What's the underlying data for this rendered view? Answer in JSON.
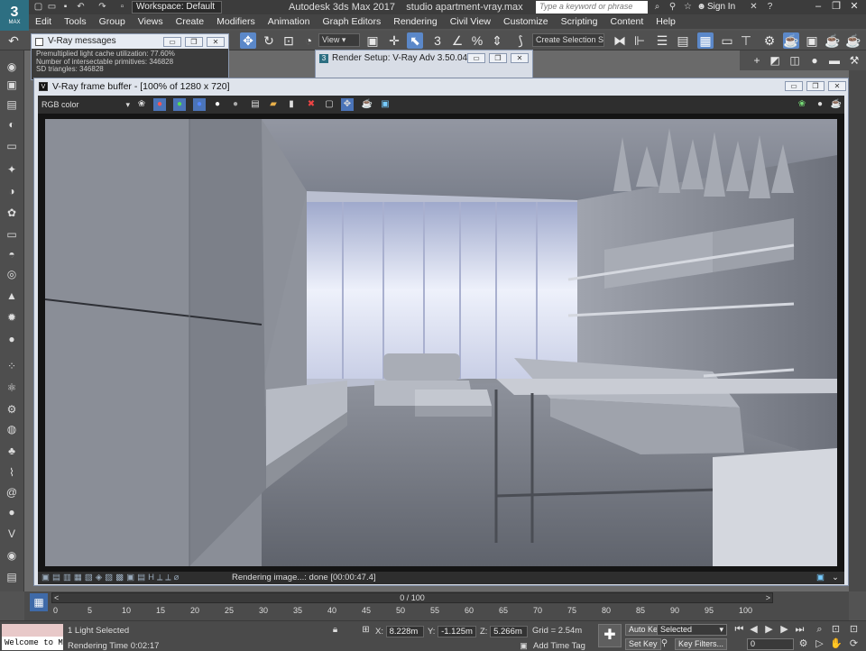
{
  "app": {
    "title": "Autodesk 3ds Max 2017",
    "file": "studio apartment-vray.max",
    "workspace": "Workspace: Default",
    "search_placeholder": "Type a keyword or phrase",
    "signin": "Sign In",
    "logo": "3",
    "logo_sub": "MAX"
  },
  "menu": [
    "Edit",
    "Tools",
    "Group",
    "Views",
    "Create",
    "Modifiers",
    "Animation",
    "Graph Editors",
    "Rendering",
    "Civil View",
    "Customize",
    "Scripting",
    "Content",
    "Help"
  ],
  "toolbar": {
    "view_select": "View",
    "selection_set": "Create Selection Se"
  },
  "vray_messages": {
    "title": "V-Ray messages",
    "lines": [
      "Premultiplied light cache utilization: 77.60%",
      "Number of intersectable primitives: 346828",
      "SD triangles: 346828"
    ]
  },
  "render_setup": {
    "title": "Render Setup: V-Ray Adv 3.50.04"
  },
  "vfb": {
    "title": "V-Ray frame buffer - [100% of 1280 x 720]",
    "channel": "RGB color",
    "status": "Rendering image...: done [00:00:47.4]"
  },
  "timeline": {
    "frame_label": "0 / 100",
    "ticks": [
      "0",
      "5",
      "10",
      "15",
      "20",
      "25",
      "30",
      "35",
      "40",
      "45",
      "50",
      "55",
      "60",
      "65",
      "70",
      "75",
      "80",
      "85",
      "90",
      "95",
      "100"
    ]
  },
  "status": {
    "selection": "1 Light Selected",
    "render_time": "Rendering Time  0:02:17",
    "welcome": "Welcome to M",
    "x_label": "X:",
    "x": "8.228m",
    "y_label": "Y:",
    "y": "-1.125m",
    "z_label": "Z:",
    "z": "5.266m",
    "grid": "Grid = 2.54m",
    "add_time_tag": "Add Time Tag",
    "auto_key": "Auto Key",
    "set_key": "Set Key",
    "selected": "Selected",
    "key_filters": "Key Filters...",
    "frame": "0"
  }
}
